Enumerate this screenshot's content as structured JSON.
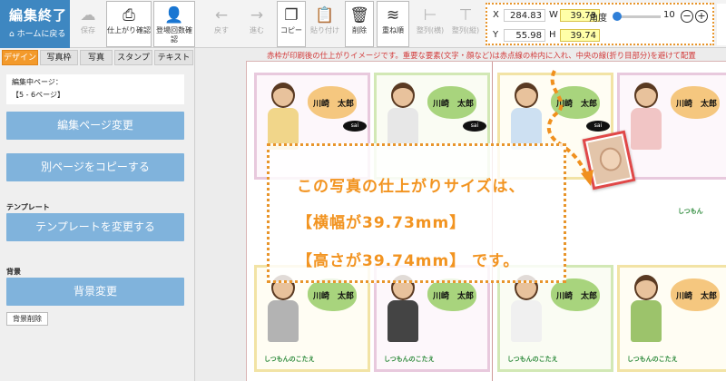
{
  "toolbar": {
    "finish": {
      "title": "編集終了",
      "subtitle": "ホームに戻る"
    },
    "buttons": [
      {
        "id": "save",
        "label": "保存",
        "icon": "☁",
        "icon_name": "cloud-upload-icon",
        "state": "disabled"
      },
      {
        "id": "finish-check",
        "label": "仕上がり確認",
        "icon": "⎙",
        "icon_name": "printer-icon",
        "state": "framed"
      },
      {
        "id": "appearance-check",
        "label": "登場回数確認",
        "icon": "👤",
        "icon_name": "person-icon",
        "state": "framed"
      },
      {
        "id": "undo",
        "label": "戻す",
        "icon": "←",
        "icon_name": "arrow-left-icon",
        "state": "disabled"
      },
      {
        "id": "redo",
        "label": "進む",
        "icon": "→",
        "icon_name": "arrow-right-icon",
        "state": "disabled"
      },
      {
        "id": "copy",
        "label": "コピー",
        "icon": "❐",
        "icon_name": "copy-icon",
        "state": "framed"
      },
      {
        "id": "paste",
        "label": "貼り付け",
        "icon": "📋",
        "icon_name": "clipboard-icon",
        "state": "disabled"
      },
      {
        "id": "delete",
        "label": "削除",
        "icon": "🗑",
        "icon_name": "trash-icon",
        "state": "framed"
      },
      {
        "id": "order",
        "label": "重ね順",
        "icon": "≋",
        "icon_name": "layers-icon",
        "state": "framed"
      },
      {
        "id": "align-h",
        "label": "整列(横)",
        "icon": "⊢",
        "icon_name": "align-horizontal-icon",
        "state": "disabled"
      },
      {
        "id": "align-v",
        "label": "整列(縦)",
        "icon": "⊤",
        "icon_name": "align-vertical-icon",
        "state": "disabled"
      }
    ]
  },
  "coords": {
    "x_label": "X",
    "x_value": "284.83",
    "w_label": "W",
    "w_value": "39.73",
    "y_label": "Y",
    "y_value": "55.98",
    "h_label": "H",
    "h_value": "39.74",
    "angle_label": "角度",
    "angle_value": "10"
  },
  "sidebar": {
    "tabs": [
      "デザイン",
      "写真枠",
      "写真",
      "スタンプ",
      "テキスト"
    ],
    "active_tab": 0,
    "edit_page_label": "編集中ページ：",
    "edit_page_value": "【5 - 6ページ】",
    "btn_change_page": "編集ページ変更",
    "btn_copy_page": "別ページをコピーする",
    "template_label": "テンプレート",
    "btn_template": "テンプレートを変更する",
    "background_label": "背景",
    "btn_background": "背景変更",
    "btn_bg_delete": "背景削除"
  },
  "canvas": {
    "warning": "赤枠が印刷後の仕上がりイメージです。重要な要素(文字・顔など)は赤点線の枠内に入れ、中央の線(折り目部分)を避けて配置",
    "card_name": "川崎　太郎",
    "card_tag": "しつもん",
    "card_tag2": "しつもんのこたえ"
  },
  "callout": {
    "line1": "この写真の仕上がりサイズは、",
    "line2": "【横幅が39.73mm】",
    "line3": "【高さが39.74mm】 です。"
  }
}
